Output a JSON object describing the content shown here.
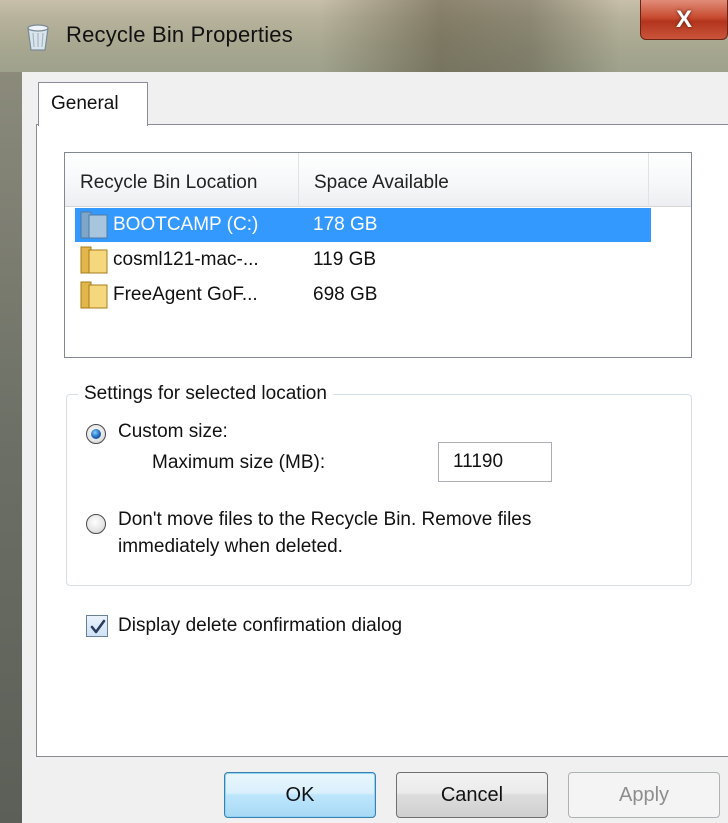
{
  "window": {
    "title": "Recycle Bin Properties",
    "close_label": "X"
  },
  "tabs": [
    {
      "label": "General",
      "selected": true
    }
  ],
  "listview": {
    "columns": [
      "Recycle Bin Location",
      "Space Available"
    ],
    "rows": [
      {
        "location": "BOOTCAMP (C:)",
        "space": "178 GB",
        "selected": true,
        "icon": "drive-folder-icon"
      },
      {
        "location": "cosml121-mac-...",
        "space": "119 GB",
        "selected": false,
        "icon": "folder-icon"
      },
      {
        "location": "FreeAgent GoF...",
        "space": "698 GB",
        "selected": false,
        "icon": "folder-icon"
      }
    ]
  },
  "settings": {
    "legend": "Settings for selected location",
    "custom_size_label": "Custom size:",
    "max_size_label": "Maximum size (MB):",
    "max_size_value": "11190",
    "custom_size_selected": true,
    "dont_move_line1": "Don't move files to the Recycle Bin. Remove files",
    "dont_move_line2": "immediately when deleted.",
    "dont_move_selected": false
  },
  "confirmation": {
    "label": "Display delete confirmation dialog",
    "checked": true
  },
  "buttons": {
    "ok": "OK",
    "cancel": "Cancel",
    "apply": "Apply"
  },
  "colors": {
    "selection": "#3399ff",
    "close_button": "#c74b30"
  }
}
